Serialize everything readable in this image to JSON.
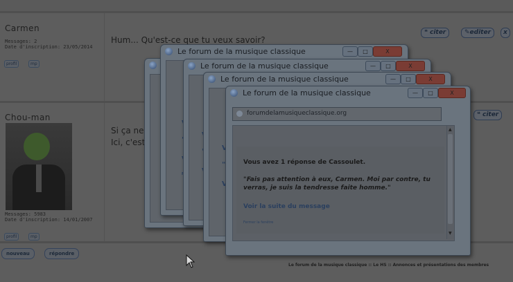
{
  "forum": {
    "posts": [
      {
        "username": "Carmen",
        "messages": "Messages: 2",
        "joined": "Date d'inscription: 23/05/2014",
        "text": "Hum... Qu'est-ce que tu veux savoir?",
        "profile_btn": "profil",
        "mp_btn": "mp",
        "actions": [
          "citer",
          "editer",
          "x"
        ]
      },
      {
        "username": "Chou-man",
        "messages": "Messages: 5983",
        "joined": "Date d'inscription: 14/01/2007",
        "text_line1": "Si ça ne",
        "text_line2": "Ici, c'est",
        "profile_btn": "profil",
        "mp_btn": "mp",
        "actions": [
          "citer"
        ]
      }
    ],
    "bottom_buttons": [
      "nouveau",
      "répondre"
    ],
    "footer": "Le forum de la musique classique :: Le HS :: Annonces et présentations des membres"
  },
  "popup": {
    "title": "Le forum de la musique classique",
    "address": "forumdelamusiqueclassique.org",
    "notice_heading_prefix": "Vous avez ",
    "notice_heading_bold": "1 réponse",
    "notice_heading_suffix": " de Cassoulet.",
    "quote": "\"Fais pas attention à eux, Carmen. Moi par contre, tu verras, je suis la tendresse faite homme.\"",
    "link": "Voir la suite du message",
    "close_link": "Fermer la fenêtre",
    "back_fragments": [
      "V",
      "\"",
      "V",
      "Fe"
    ],
    "controls": {
      "minimize": "—",
      "maximize": "□",
      "close": "X"
    }
  },
  "colors": {
    "dim_overlay": "#5d5d5d",
    "link": "#2a3f5e",
    "close_button": "#7a3c34"
  }
}
